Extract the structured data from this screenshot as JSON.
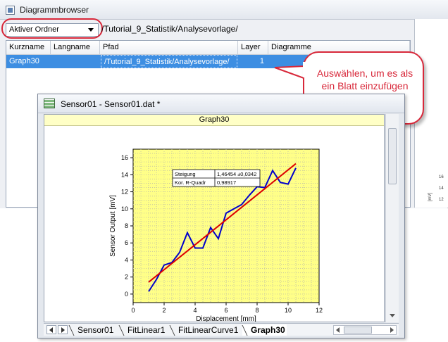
{
  "browser": {
    "title": "Diagrammbrowser",
    "folder_select": "Aktiver Ordner",
    "folder_path": "/Tutorial_9_Statistik/Analysevorlage/",
    "columns": [
      "Kurzname",
      "Langname",
      "Pfad",
      "Layer",
      "Diagramme"
    ],
    "rows": [
      {
        "kurzname": "Graph30",
        "langname": "",
        "pfad": "/Tutorial_9_Statistik/Analysevorlage/",
        "layer": "1",
        "diagramme": ""
      }
    ]
  },
  "right_panel": {
    "ylabel": "[mV]",
    "ticks": [
      "16",
      "14",
      "12"
    ]
  },
  "callout": {
    "text": "Auswählen, um es als ein Blatt einzufügen"
  },
  "sensor_window": {
    "title": "Sensor01 - Sensor01.dat *",
    "graph_title": "Graph30",
    "tabs": [
      "Sensor01",
      "FitLinear1",
      "FitLinearCurve1",
      "Graph30"
    ],
    "active_tab": "Graph30"
  },
  "colors": {
    "plot_bg": "#ffff88",
    "data_line": "#0000cc",
    "fit_line": "#dd0000",
    "accent_red": "#d8283a",
    "selection": "#3d8ee2"
  },
  "chart_data": {
    "type": "line",
    "xlabel": "Displacement [mm]",
    "ylabel": "Sensor Output [mV]",
    "xlim": [
      0,
      12
    ],
    "ylim": [
      -1,
      17
    ],
    "xticks": [
      0,
      2,
      4,
      6,
      8,
      10,
      12
    ],
    "yticks": [
      0,
      2,
      4,
      6,
      8,
      10,
      12,
      14,
      16
    ],
    "grid": true,
    "series": [
      {
        "x": [
          1.0,
          1.5,
          2.0,
          2.5,
          3.0,
          3.5,
          4.0,
          4.5,
          5.0,
          5.5,
          6.0,
          6.5,
          7.0,
          7.5,
          8.0,
          8.5,
          9.0,
          9.5,
          10.0,
          10.5
        ],
        "values": [
          0.3,
          1.7,
          3.4,
          3.7,
          4.9,
          7.2,
          5.4,
          5.4,
          7.8,
          6.5,
          9.5,
          10.0,
          10.5,
          11.6,
          12.6,
          12.5,
          14.5,
          13.1,
          12.9,
          14.8
        ]
      },
      {
        "x": [
          1.0,
          10.5
        ],
        "values": [
          1.4,
          15.3
        ]
      }
    ],
    "annotation": {
      "rows": [
        {
          "label": "Steigung",
          "value": "1,46454 ±0,0342"
        },
        {
          "label": "Kor. R-Quadr",
          "value": "0,98917"
        }
      ]
    }
  }
}
